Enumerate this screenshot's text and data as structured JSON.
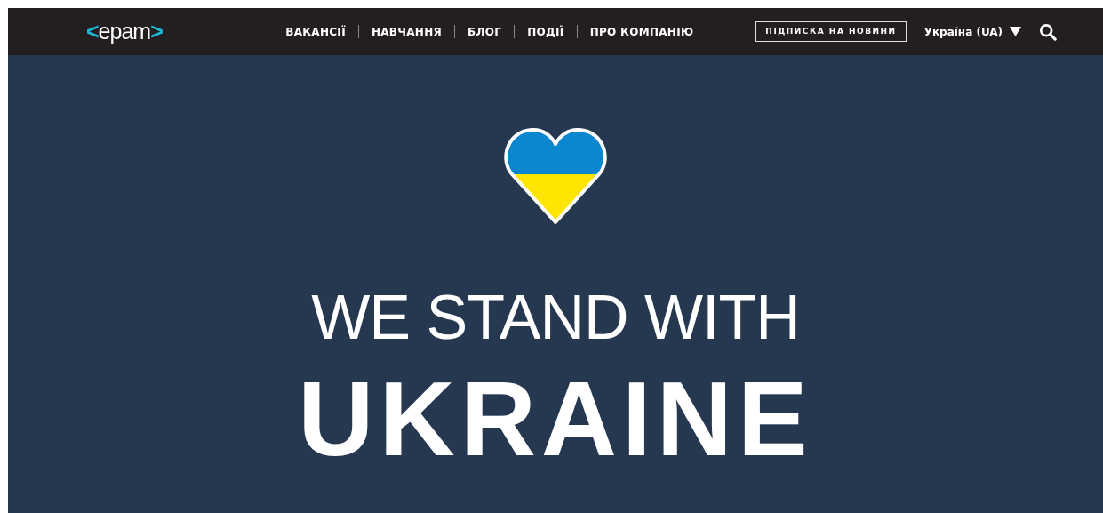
{
  "logo": [
    "<",
    "epam",
    ">"
  ],
  "nav": [
    "ВАКАНСІЇ",
    "НАВЧАННЯ",
    "БЛОГ",
    "ПОДІЇ",
    "ПРО КОМПАНІЮ"
  ],
  "subscribe_button": "ПІДПИСКА НА НОВИНИ",
  "language": "Україна (UA)",
  "hero": {
    "line_1": "WE STAND WITH",
    "line_2": "UKRAINE"
  }
}
